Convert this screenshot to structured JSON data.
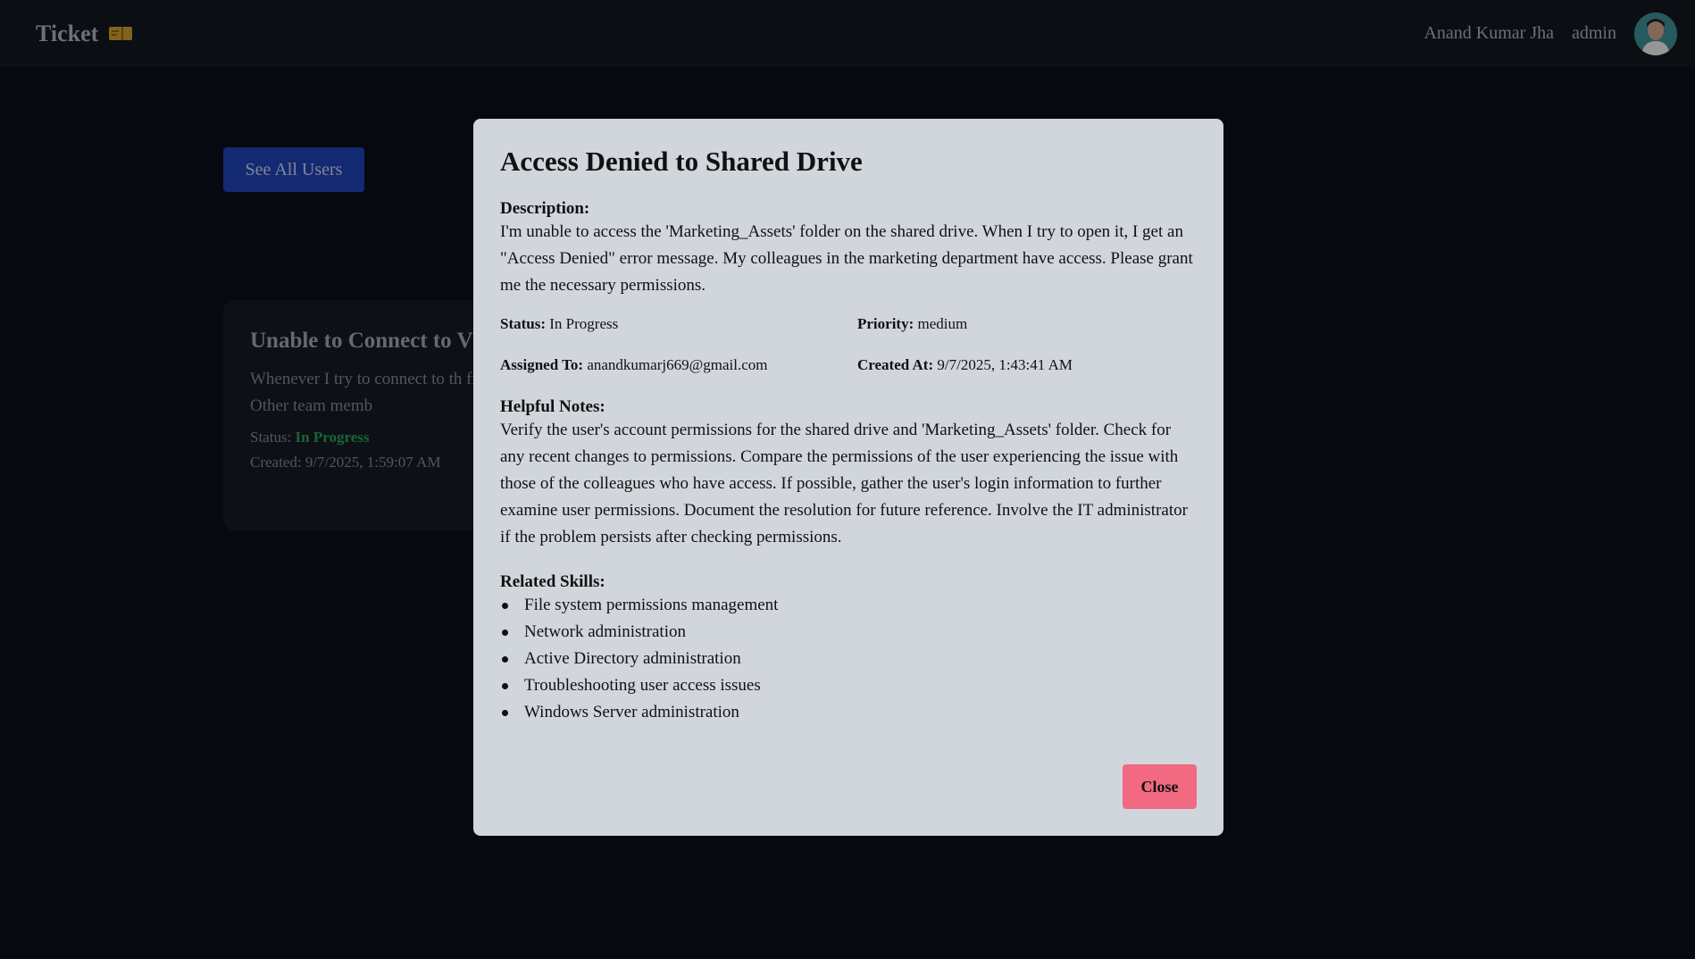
{
  "navbar": {
    "brand": "Ticket",
    "brand_icon": "ticket-icon",
    "user_name": "Anand Kumar Jha",
    "role": "admin",
    "avatar_icon": "avatar"
  },
  "page": {
    "see_all_users_label": "See All Users",
    "ticket_card": {
      "title": "Unable to Connect to V",
      "description": "Whenever I try to connect to th from my laptop, it fails with an failed\" error. Other team memb",
      "status_label": "Status:",
      "status_value": "In Progress",
      "created": "Created: 9/7/2025, 1:59:07 AM"
    }
  },
  "modal": {
    "title": "Access Denied to Shared Drive",
    "description_label": "Description:",
    "description": "I'm unable to access the 'Marketing_Assets' folder on the shared drive. When I try to open it, I get an \"Access Denied\" error message. My colleagues in the marketing department have access. Please grant me the necessary permissions.",
    "status_label": "Status:",
    "status_value": "In Progress",
    "priority_label": "Priority:",
    "priority_value": "medium",
    "assigned_label": "Assigned To:",
    "assigned_value": "anandkumarj669@gmail.com",
    "created_label": "Created At:",
    "created_value": "9/7/2025, 1:43:41 AM",
    "notes_label": "Helpful Notes:",
    "notes": "Verify the user's account permissions for the shared drive and 'Marketing_Assets' folder. Check for any recent changes to permissions. Compare the permissions of the user experiencing the issue with those of the colleagues who have access. If possible, gather the user's login information to further examine user permissions. Document the resolution for future reference. Involve the IT administrator if the problem persists after checking permissions.",
    "skills_label": "Related Skills:",
    "skills": [
      "File system permissions management",
      "Network administration",
      "Active Directory administration",
      "Troubleshooting user access issues",
      "Windows Server administration"
    ],
    "close_label": "Close"
  },
  "colors": {
    "background": "#0a0f1a",
    "navbar": "#12161e",
    "primary_button": "#1e40af",
    "modal": "#d1d6dc",
    "close_button": "#f26a82",
    "status_green": "#2a9a52"
  }
}
